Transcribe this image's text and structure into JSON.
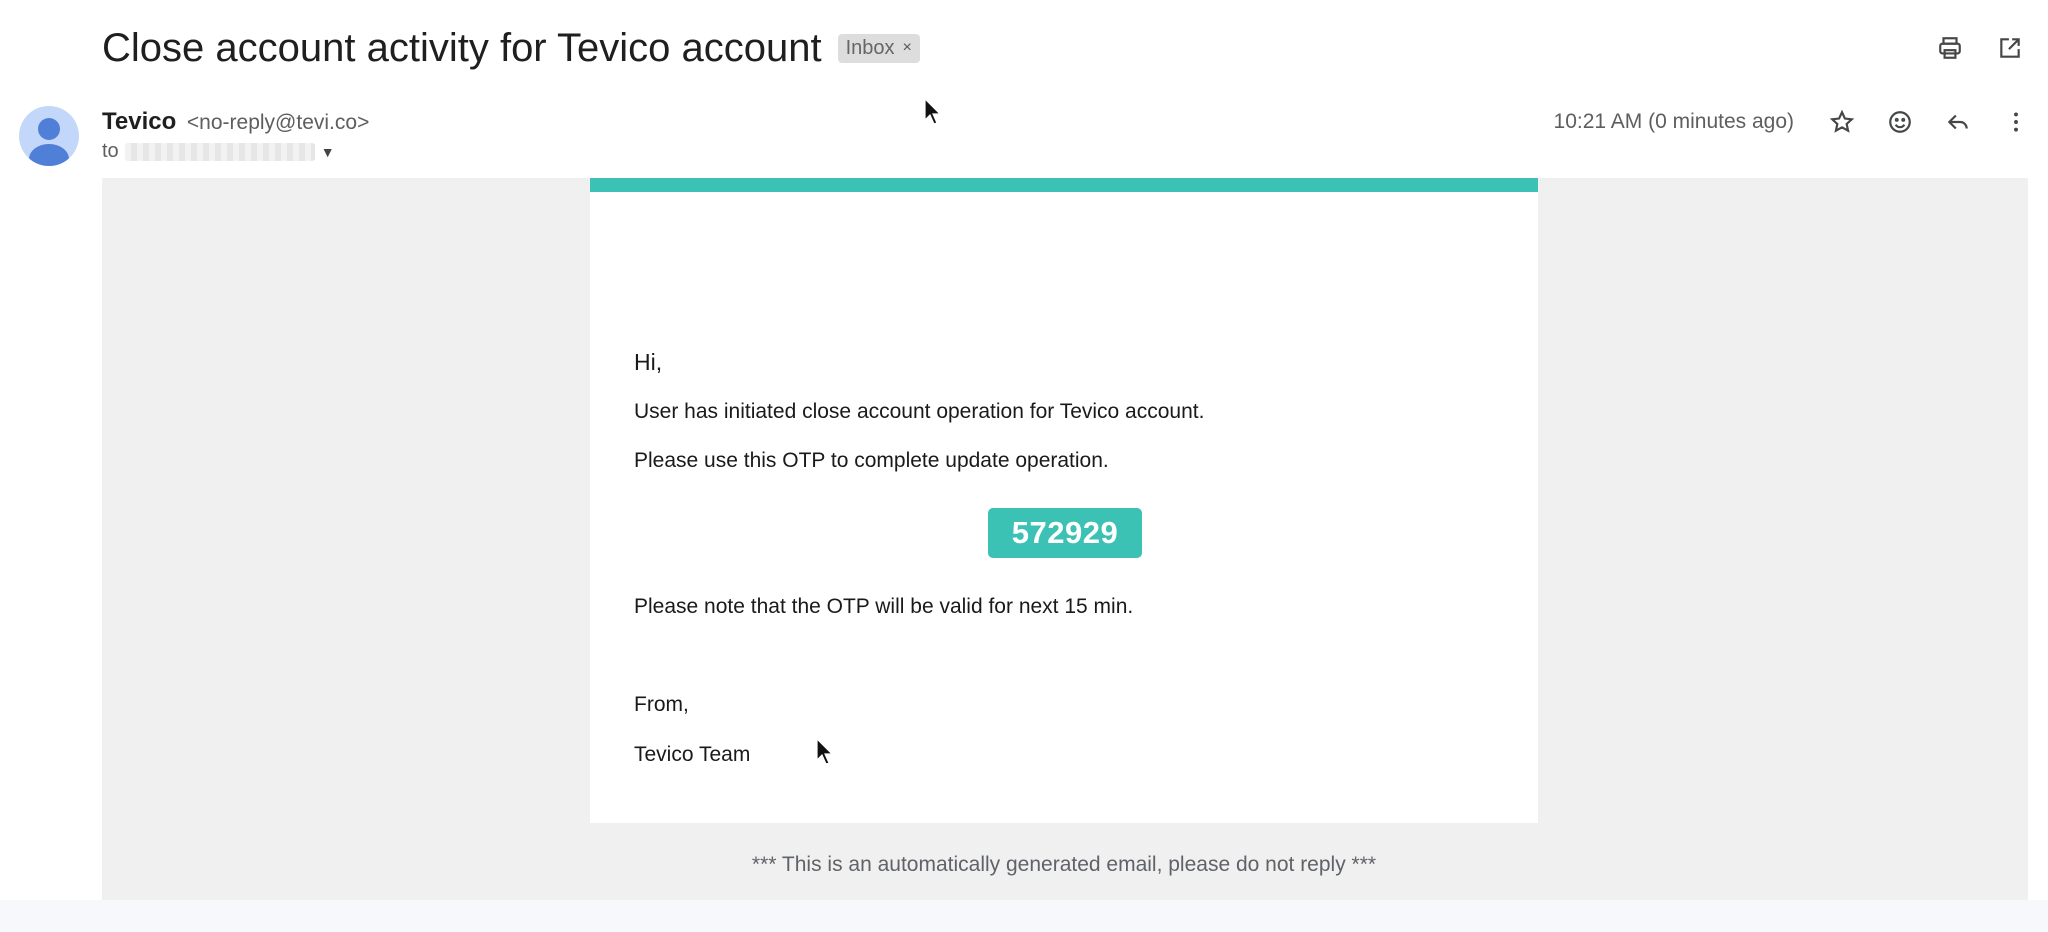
{
  "email": {
    "subject": "Close account activity for Tevico account",
    "label_chip": "Inbox",
    "label_remove": "×",
    "sender_name": "Tevico",
    "sender_email": "<no-reply@tevi.co>",
    "to_prefix": "to",
    "timestamp": "10:21 AM (0 minutes ago)"
  },
  "icons": {
    "print": "print-icon",
    "open_new_window": "open-in-new-window-icon",
    "star": "star-icon",
    "emoji": "emoji-react-icon",
    "reply": "reply-icon",
    "more": "more-vertical-icon",
    "avatar": "default-avatar-icon",
    "dropdown": "chevron-down-icon"
  },
  "body": {
    "greeting": "Hi,",
    "line1": "User has initiated close account operation for Tevico account.",
    "line2": "Please use this OTP to complete update operation.",
    "otp": "572929",
    "line3": "Please note that the OTP will be valid for next 15 min.",
    "closing": "From,",
    "signature": "Tevico Team",
    "footer": "*** This is an automatically generated email, please do not reply ***"
  },
  "colors": {
    "accent": "#3cc2b5",
    "body_background": "#f0f0f0"
  }
}
